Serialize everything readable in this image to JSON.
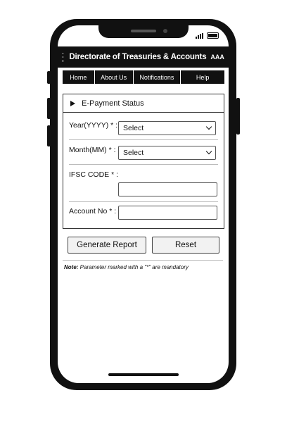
{
  "app": {
    "title": "Directorate of Treasuries & Accounts",
    "font_size_toggle": "AAA"
  },
  "nav": {
    "items": [
      "Home",
      "About Us",
      "Notifications",
      "Help"
    ]
  },
  "panel": {
    "title": "E-Payment Status"
  },
  "form": {
    "year_label": "Year(YYYY) * :",
    "year_value": "Select",
    "month_label": "Month(MM) * :",
    "month_value": "Select",
    "ifsc_label": "IFSC CODE * :",
    "ifsc_value": "",
    "account_label": "Account No * :",
    "account_value": ""
  },
  "actions": {
    "generate_label": "Generate Report",
    "reset_label": "Reset"
  },
  "note": {
    "prefix": "Note:",
    "text": " Parameter marked with a \"*\" are mandatory"
  },
  "colors": {
    "header_bg": "#111111",
    "header_text": "#ffffff"
  }
}
